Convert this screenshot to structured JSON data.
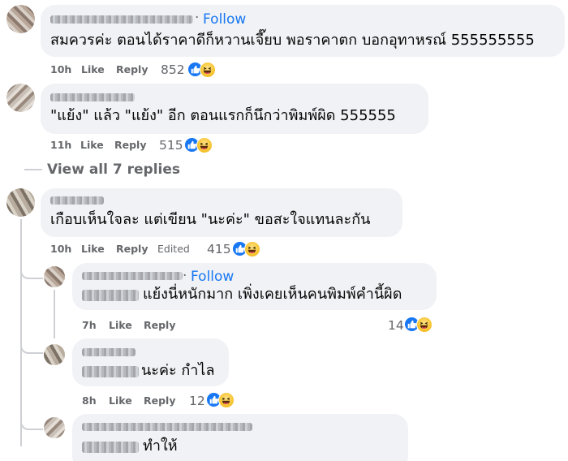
{
  "comments": [
    {
      "follow": "Follow",
      "text": "สมควรค่ะ ตอนได้ราคาดีก็หวานเจี๊ยบ พอราคาตก บอกอุทาหรณ์ 555555555",
      "time": "10h",
      "like": "Like",
      "reply": "Reply",
      "count": "852"
    },
    {
      "text": "\"แย้ง\" แล้ว \"แย้ง\" อีก ตอนแรกก็นึกว่าพิมพ์ผิด 555555",
      "time": "11h",
      "like": "Like",
      "reply": "Reply",
      "count": "515"
    },
    {
      "text": "เกือบเห็นใจละ แต่เขียน \"นะค่ะ\" ขอสะใจแทนละกัน",
      "time": "10h",
      "like": "Like",
      "reply": "Reply",
      "edited": "Edited",
      "count": "415"
    }
  ],
  "view_replies": "View all 7 replies",
  "replies": [
    {
      "follow": "Follow",
      "text": "แย้งนี่หนักมาก เพิ่งเคยเห็นคนพิมพ์คำนี้ผิด",
      "time": "7h",
      "like": "Like",
      "reply": "Reply",
      "count": "14"
    },
    {
      "text": "นะค่ะ กำไล",
      "time": "8h",
      "like": "Like",
      "reply": "Reply",
      "count": "12"
    },
    {
      "text": "ทำให้"
    }
  ],
  "colors": {
    "link": "#1877f2",
    "bubble": "#f0f2f5",
    "meta": "#65676b"
  }
}
